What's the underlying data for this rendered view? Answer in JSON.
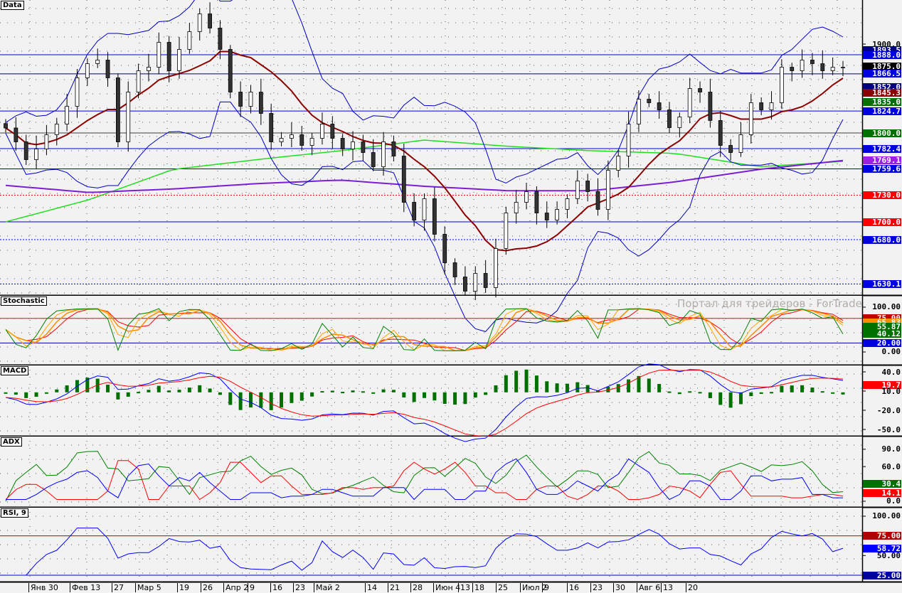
{
  "watermark": "Портал для трейдеров - ForTrader.ru",
  "panels": [
    {
      "title": "Data",
      "range": [
        1617.6,
        1949.6
      ]
    },
    {
      "title": "Stochastic",
      "range": [
        -28.6,
        125.4
      ]
    },
    {
      "title": "MACD",
      "range": [
        -60,
        50
      ]
    },
    {
      "title": "ADX",
      "range": [
        -9.9,
        112
      ]
    },
    {
      "title": "RSI, 9",
      "range": [
        16.9,
        110.8
      ]
    }
  ],
  "x_labels": [
    "Янв 30",
    "Фев 13",
    "27",
    "Мар 5",
    "19",
    "26",
    "Апр 2",
    "9",
    "16",
    "23",
    "Май 2",
    "14",
    "21",
    "28",
    "Июн 4",
    "13",
    "18",
    "25",
    "Июл 2",
    "9",
    "16",
    "23",
    "30",
    "Авг 6",
    "13",
    "20"
  ],
  "chart_data": {
    "type": "candlestick",
    "closes": [
      1805.6,
      1790,
      1770,
      1782,
      1798,
      1810,
      1830,
      1862,
      1878,
      1882,
      1862,
      1790,
      1846,
      1870,
      1874,
      1902,
      1870,
      1894,
      1914,
      1934,
      1918,
      1894,
      1846,
      1830,
      1846,
      1822,
      1790,
      1794,
      1798,
      1786,
      1794,
      1810,
      1794,
      1782,
      1790,
      1778,
      1762,
      1790,
      1774,
      1722,
      1702,
      1726,
      1686,
      1654,
      1638,
      1622,
      1642,
      1626,
      1670,
      1710,
      1722,
      1734,
      1710,
      1702,
      1714,
      1726,
      1746,
      1734,
      1714,
      1758,
      1774,
      1810,
      1838,
      1834,
      1826,
      1806,
      1818,
      1850,
      1846,
      1814,
      1786,
      1778,
      1798,
      1834,
      1826,
      1834,
      1874,
      1870,
      1882,
      1878,
      1870,
      1874,
      1874
    ],
    "ma_green": [
      1700,
      1725,
      1759,
      1770,
      1780,
      1792,
      1785,
      1780,
      1777,
      1762,
      1768
    ],
    "ma_purple": [
      1741,
      1733,
      1737,
      1743,
      1747,
      1740,
      1735,
      1735,
      1745,
      1759,
      1769
    ],
    "colors": {
      "sma": "#8b0000",
      "bands": "#0000c0",
      "ma_green": "#22dd22",
      "ma_purple": "#7a1fd6"
    },
    "levels": [
      {
        "v": 1900.0,
        "label": "1900.0",
        "bg": "",
        "line": ""
      },
      {
        "v": 1893.5,
        "label": "1893.5",
        "bg": "#000080",
        "line": ""
      },
      {
        "v": 1888.0,
        "label": "1888.0",
        "bg": "#0000e0",
        "line": "#0000e0"
      },
      {
        "v": 1875.0,
        "label": "1875.0",
        "bg": "#000000",
        "line": ""
      },
      {
        "v": 1866.5,
        "label": "1866.5",
        "bg": "#0000e0",
        "line": "#000080"
      },
      {
        "v": 1852.0,
        "label": "1852.0",
        "bg": "#000080",
        "line": ""
      },
      {
        "v": 1845.3,
        "label": "1845.3",
        "bg": "#8b0000",
        "line": ""
      },
      {
        "v": 1835.0,
        "label": "1835.0",
        "bg": "#007000",
        "line": ""
      },
      {
        "v": 1824.7,
        "label": "1824.7",
        "bg": "#0000e0",
        "line": "#0000e0"
      },
      {
        "v": 1800.0,
        "label": "1800.0",
        "bg": "#007000",
        "line": "#404040"
      },
      {
        "v": 1782.4,
        "label": "1782.4",
        "bg": "#0000e0",
        "line": "#0000e0"
      },
      {
        "v": 1769.1,
        "label": "1769.1",
        "bg": "#9b1fe6",
        "line": ""
      },
      {
        "v": 1759.6,
        "label": "1759.6",
        "bg": "#0000e0",
        "line": "#0000e0"
      },
      {
        "v": 1730.0,
        "label": "1730.0",
        "bg": "#ff0000",
        "line": "#ff0000",
        "dash": true
      },
      {
        "v": 1700.0,
        "label": "1700.0",
        "bg": "#ff0000",
        "line": "#0000e0"
      },
      {
        "v": 1680.0,
        "label": "1680.0",
        "bg": "#0000e0",
        "line": "#0000e0",
        "dash": true
      },
      {
        "v": 1630.1,
        "label": "1630.1",
        "bg": "#0000e0",
        "line": "#0000e0",
        "dash": true
      }
    ],
    "stochastic": {
      "levels": [
        {
          "v": 100,
          "label": "100.00",
          "bg": ""
        },
        {
          "v": 75,
          "label": "75.00",
          "bg": "#c00000",
          "line": "#ff0000"
        },
        {
          "v": 65.83,
          "label": "65.83",
          "bg": "#ff8c00"
        },
        {
          "v": 55.87,
          "label": "55.87",
          "bg": "#007000"
        },
        {
          "v": 40.12,
          "label": "40.12",
          "bg": "#007000"
        },
        {
          "v": 20,
          "label": "20.00",
          "bg": "#0000e0",
          "line": "#0000c0"
        },
        {
          "v": 0,
          "label": "0.00",
          "bg": ""
        }
      ]
    },
    "macd": {
      "levels": [
        {
          "v": 40,
          "label": "40.0",
          "bg": ""
        },
        {
          "v": 19.7,
          "label": "19.7",
          "bg": "#ff0000"
        },
        {
          "v": 10,
          "label": "10.0",
          "bg": ""
        },
        {
          "v": -20,
          "label": "-20.0",
          "bg": ""
        },
        {
          "v": -50,
          "label": "-50.0",
          "bg": ""
        }
      ]
    },
    "adx": {
      "levels": [
        {
          "v": 90,
          "label": "90.0",
          "bg": ""
        },
        {
          "v": 60,
          "label": "60.0",
          "bg": ""
        },
        {
          "v": 30.4,
          "label": "30.4",
          "bg": "#007000"
        },
        {
          "v": 14.1,
          "label": "14.1",
          "bg": "#ff0000"
        },
        {
          "v": 0,
          "label": "0.0",
          "bg": ""
        }
      ]
    },
    "rsi": {
      "levels": [
        {
          "v": 100,
          "label": "100.00",
          "bg": ""
        },
        {
          "v": 75,
          "label": "75.00",
          "bg": "#b00000",
          "line": "#c00000"
        },
        {
          "v": 58.72,
          "label": "58.72",
          "bg": "#0000ff"
        },
        {
          "v": 50,
          "label": "50.00",
          "bg": ""
        },
        {
          "v": 25,
          "label": "25.00",
          "bg": "#0000a0",
          "line": "#0000c0"
        }
      ]
    }
  }
}
